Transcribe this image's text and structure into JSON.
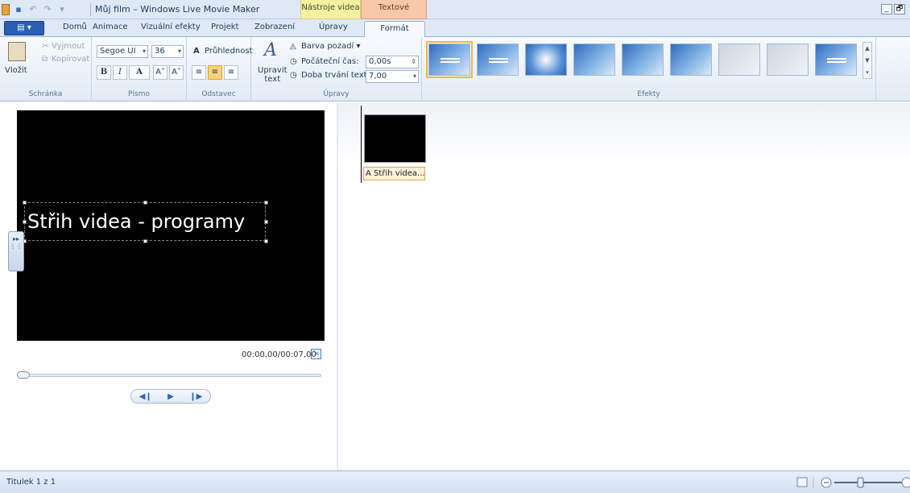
{
  "window": {
    "title": "Můj film – Windows Live Movie Maker",
    "context_tab_video": "Nástroje videa",
    "context_tab_text": "Textové nástroje",
    "minimize": "_",
    "restore": "🗗"
  },
  "tabs": {
    "file_menu": "▤ ▾",
    "home": "Domů",
    "animations": "Animace",
    "visual_effects": "Vizuální efekty",
    "project": "Projekt",
    "view": "Zobrazení",
    "edit": "Úpravy",
    "format": "Formát"
  },
  "ribbon": {
    "clipboard": {
      "label": "Schránka",
      "paste": "Vložit",
      "cut": "Vyjmout",
      "copy": "Kopírovat"
    },
    "font": {
      "label": "Písmo",
      "family": "Segoe UI",
      "size": "36",
      "bold": "B",
      "italic": "I",
      "font_color": "A",
      "grow": "A˄",
      "shrink": "A˅"
    },
    "paragraph": {
      "label": "Odstavec",
      "transparency": "Průhlednost"
    },
    "edit": {
      "label": "Úpravy",
      "edit_text_line1": "Upravit",
      "edit_text_line2": "text",
      "background_color": "Barva pozadí",
      "start_time_label": "Počáteční čas:",
      "start_time_value": "0,00s",
      "duration_label": "Doba trvání textu:",
      "duration_value": "7,00"
    },
    "effects": {
      "label": "Efekty"
    }
  },
  "preview": {
    "caption": "Střih videa - programy",
    "timecode": "00:00,00/00:07,00"
  },
  "storyboard": {
    "clip_caption": "A Střih videa..."
  },
  "status": {
    "text": "Titulek 1 z 1"
  },
  "colors": {
    "accent": "#2b5fb5",
    "context_video": "#f4f0a0",
    "context_text": "#f7c8a9",
    "selected_effect": "#f0b840"
  }
}
